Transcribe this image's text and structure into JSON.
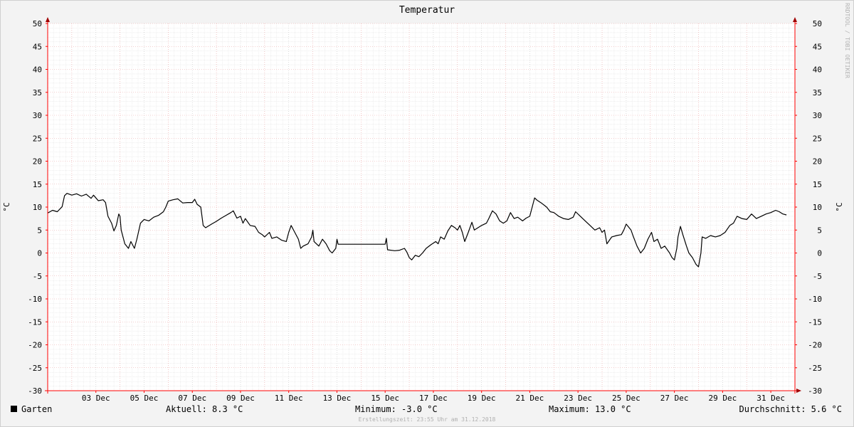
{
  "side_label": "RRDTOOL / TOBI OETIKER",
  "legend": {
    "series_name": "Garten",
    "series_color": "#000000",
    "current": "Aktuell: 8.3 °C",
    "minimum": "Minimum: -3.0 °C",
    "maximum": "Maximum: 13.0 °C",
    "average": "Durchschnitt: 5.6 °C"
  },
  "footer": "Erstellungszeit: 23:55 Uhr am 31.12.2018",
  "chart_data": {
    "type": "line",
    "title": "Temperatur",
    "ylabel": "°C",
    "y2label": "°C",
    "ylim": [
      -30,
      50
    ],
    "yticks": [
      -30,
      -25,
      -20,
      -15,
      -10,
      -5,
      0,
      5,
      10,
      15,
      20,
      25,
      30,
      35,
      40,
      45,
      50
    ],
    "xlim": [
      1,
      32
    ],
    "xticks": [
      {
        "x": 3,
        "label": "03 Dec"
      },
      {
        "x": 5,
        "label": "05 Dec"
      },
      {
        "x": 7,
        "label": "07 Dec"
      },
      {
        "x": 9,
        "label": "09 Dec"
      },
      {
        "x": 11,
        "label": "11 Dec"
      },
      {
        "x": 13,
        "label": "13 Dec"
      },
      {
        "x": 15,
        "label": "15 Dec"
      },
      {
        "x": 17,
        "label": "17 Dec"
      },
      {
        "x": 19,
        "label": "19 Dec"
      },
      {
        "x": 21,
        "label": "21 Dec"
      },
      {
        "x": 23,
        "label": "23 Dec"
      },
      {
        "x": 25,
        "label": "25 Dec"
      },
      {
        "x": 27,
        "label": "27 Dec"
      },
      {
        "x": 29,
        "label": "29 Dec"
      },
      {
        "x": 31,
        "label": "31 Dec"
      }
    ],
    "grid": true,
    "series": [
      {
        "name": "Garten",
        "color": "#000000",
        "points": [
          [
            1.0,
            8.7
          ],
          [
            1.2,
            9.3
          ],
          [
            1.4,
            9.0
          ],
          [
            1.6,
            10.1
          ],
          [
            1.7,
            12.5
          ],
          [
            1.8,
            13.0
          ],
          [
            2.0,
            12.6
          ],
          [
            2.2,
            12.9
          ],
          [
            2.4,
            12.4
          ],
          [
            2.6,
            12.8
          ],
          [
            2.8,
            11.9
          ],
          [
            2.9,
            12.6
          ],
          [
            3.1,
            11.4
          ],
          [
            3.3,
            11.6
          ],
          [
            3.4,
            11.0
          ],
          [
            3.5,
            8.0
          ],
          [
            3.65,
            6.5
          ],
          [
            3.75,
            4.8
          ],
          [
            3.85,
            6.0
          ],
          [
            3.95,
            8.5
          ],
          [
            4.0,
            8.0
          ],
          [
            4.05,
            5.0
          ],
          [
            4.2,
            2.0
          ],
          [
            4.35,
            1.0
          ],
          [
            4.45,
            2.5
          ],
          [
            4.6,
            1.0
          ],
          [
            4.7,
            3.0
          ],
          [
            4.85,
            6.5
          ],
          [
            5.0,
            7.3
          ],
          [
            5.2,
            7.0
          ],
          [
            5.4,
            7.8
          ],
          [
            5.6,
            8.2
          ],
          [
            5.8,
            9.0
          ],
          [
            5.9,
            10.0
          ],
          [
            6.0,
            11.3
          ],
          [
            6.2,
            11.6
          ],
          [
            6.4,
            11.8
          ],
          [
            6.6,
            10.9
          ],
          [
            6.8,
            11.0
          ],
          [
            7.0,
            11.0
          ],
          [
            7.1,
            11.7
          ],
          [
            7.2,
            10.6
          ],
          [
            7.35,
            10.0
          ],
          [
            7.45,
            6.0
          ],
          [
            7.55,
            5.5
          ],
          [
            7.8,
            6.3
          ],
          [
            8.0,
            6.9
          ],
          [
            8.2,
            7.6
          ],
          [
            8.4,
            8.2
          ],
          [
            8.6,
            8.8
          ],
          [
            8.7,
            9.2
          ],
          [
            8.85,
            7.6
          ],
          [
            9.0,
            8.0
          ],
          [
            9.1,
            6.5
          ],
          [
            9.2,
            7.5
          ],
          [
            9.4,
            6.0
          ],
          [
            9.6,
            5.8
          ],
          [
            9.75,
            4.5
          ],
          [
            9.9,
            4.0
          ],
          [
            10.0,
            3.5
          ],
          [
            10.2,
            4.5
          ],
          [
            10.3,
            3.2
          ],
          [
            10.5,
            3.5
          ],
          [
            10.7,
            2.8
          ],
          [
            10.9,
            2.5
          ],
          [
            11.0,
            4.5
          ],
          [
            11.1,
            6.0
          ],
          [
            11.25,
            4.5
          ],
          [
            11.4,
            3.0
          ],
          [
            11.5,
            1.0
          ],
          [
            11.6,
            1.5
          ],
          [
            11.8,
            2.0
          ],
          [
            11.95,
            3.5
          ],
          [
            12.0,
            5.0
          ],
          [
            12.05,
            2.5
          ],
          [
            12.25,
            1.5
          ],
          [
            12.4,
            3.0
          ],
          [
            12.55,
            2.0
          ],
          [
            12.7,
            0.5
          ],
          [
            12.8,
            0.0
          ],
          [
            12.95,
            1.0
          ],
          [
            13.0,
            3.0
          ],
          [
            13.05,
            1.9
          ],
          [
            15.0,
            1.9
          ],
          [
            15.05,
            3.2
          ],
          [
            15.1,
            0.7
          ],
          [
            15.4,
            0.5
          ],
          [
            15.6,
            0.6
          ],
          [
            15.8,
            1.0
          ],
          [
            15.9,
            0.2
          ],
          [
            16.0,
            -1.0
          ],
          [
            16.1,
            -1.5
          ],
          [
            16.25,
            -0.5
          ],
          [
            16.4,
            -0.8
          ],
          [
            16.55,
            0.0
          ],
          [
            16.7,
            1.0
          ],
          [
            16.9,
            1.8
          ],
          [
            17.1,
            2.5
          ],
          [
            17.2,
            2.0
          ],
          [
            17.3,
            3.5
          ],
          [
            17.45,
            3.0
          ],
          [
            17.6,
            4.8
          ],
          [
            17.75,
            6.0
          ],
          [
            17.9,
            5.5
          ],
          [
            18.0,
            5.0
          ],
          [
            18.1,
            6.0
          ],
          [
            18.2,
            4.5
          ],
          [
            18.3,
            2.5
          ],
          [
            18.45,
            4.5
          ],
          [
            18.6,
            6.7
          ],
          [
            18.7,
            5.0
          ],
          [
            18.85,
            5.5
          ],
          [
            19.0,
            6.0
          ],
          [
            19.2,
            6.5
          ],
          [
            19.3,
            7.5
          ],
          [
            19.45,
            9.2
          ],
          [
            19.6,
            8.5
          ],
          [
            19.75,
            7.0
          ],
          [
            19.9,
            6.5
          ],
          [
            20.05,
            7.0
          ],
          [
            20.2,
            8.8
          ],
          [
            20.35,
            7.5
          ],
          [
            20.5,
            7.8
          ],
          [
            20.7,
            7.0
          ],
          [
            20.85,
            7.6
          ],
          [
            21.0,
            8.0
          ],
          [
            21.1,
            10.0
          ],
          [
            21.2,
            12.0
          ],
          [
            21.3,
            11.5
          ],
          [
            21.5,
            10.8
          ],
          [
            21.7,
            10.0
          ],
          [
            21.85,
            9.0
          ],
          [
            22.0,
            8.8
          ],
          [
            22.2,
            8.0
          ],
          [
            22.4,
            7.5
          ],
          [
            22.6,
            7.3
          ],
          [
            22.8,
            7.8
          ],
          [
            22.9,
            9.0
          ],
          [
            23.1,
            8.0
          ],
          [
            23.3,
            7.0
          ],
          [
            23.5,
            6.0
          ],
          [
            23.7,
            5.0
          ],
          [
            23.9,
            5.5
          ],
          [
            24.0,
            4.5
          ],
          [
            24.1,
            5.0
          ],
          [
            24.2,
            2.0
          ],
          [
            24.4,
            3.5
          ],
          [
            24.6,
            3.8
          ],
          [
            24.8,
            4.0
          ],
          [
            24.9,
            5.0
          ],
          [
            25.0,
            6.3
          ],
          [
            25.2,
            5.0
          ],
          [
            25.3,
            3.5
          ],
          [
            25.45,
            1.5
          ],
          [
            25.6,
            0.0
          ],
          [
            25.75,
            1.0
          ],
          [
            25.9,
            3.0
          ],
          [
            26.05,
            4.5
          ],
          [
            26.15,
            2.5
          ],
          [
            26.3,
            3.0
          ],
          [
            26.45,
            1.0
          ],
          [
            26.6,
            1.5
          ],
          [
            26.8,
            0.0
          ],
          [
            26.9,
            -1.0
          ],
          [
            27.0,
            -1.5
          ],
          [
            27.1,
            1.0
          ],
          [
            27.15,
            3.5
          ],
          [
            27.25,
            5.8
          ],
          [
            27.35,
            4.0
          ],
          [
            27.5,
            1.5
          ],
          [
            27.6,
            0.0
          ],
          [
            27.75,
            -1.0
          ],
          [
            27.9,
            -2.5
          ],
          [
            28.0,
            -3.0
          ],
          [
            28.1,
            0.0
          ],
          [
            28.15,
            3.5
          ],
          [
            28.3,
            3.2
          ],
          [
            28.5,
            3.8
          ],
          [
            28.7,
            3.5
          ],
          [
            28.9,
            3.8
          ],
          [
            29.1,
            4.5
          ],
          [
            29.3,
            6.0
          ],
          [
            29.45,
            6.5
          ],
          [
            29.6,
            8.0
          ],
          [
            29.8,
            7.5
          ],
          [
            30.0,
            7.3
          ],
          [
            30.2,
            8.5
          ],
          [
            30.4,
            7.5
          ],
          [
            30.6,
            8.0
          ],
          [
            30.8,
            8.5
          ],
          [
            31.0,
            8.8
          ],
          [
            31.2,
            9.3
          ],
          [
            31.35,
            9.0
          ],
          [
            31.5,
            8.5
          ],
          [
            31.65,
            8.3
          ]
        ]
      }
    ]
  }
}
